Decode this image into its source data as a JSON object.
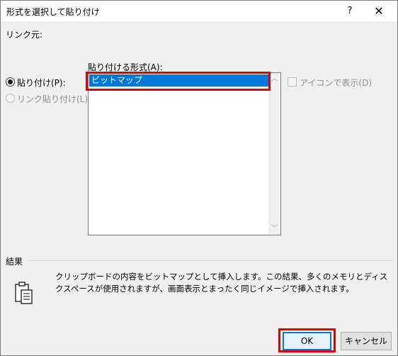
{
  "window": {
    "title": "形式を選択して貼り付け",
    "help_label": "?",
    "close_label": "✕"
  },
  "source": {
    "label": "リンク元:"
  },
  "paste_format": {
    "label": "貼り付ける形式(A):",
    "items": [
      {
        "label": "ビットマップ",
        "selected": true
      }
    ]
  },
  "options": {
    "paste_label": "貼り付け(P):",
    "paste_checked": true,
    "link_paste_label": "リンク貼り付け(L):",
    "link_paste_enabled": false
  },
  "display_as_icon": {
    "label": "アイコンで表示(D)",
    "checked": false,
    "enabled": false
  },
  "result": {
    "heading": "結果",
    "description": "クリップボードの内容をビットマップとして挿入します。この結果、多くのメモリとディスクスペースが使用されますが、画面表示とまったく同じイメージで挿入されます。"
  },
  "buttons": {
    "ok_label": "OK",
    "cancel_label": "キャンセル"
  },
  "colors": {
    "selection": "#0078d7",
    "highlight_box": "#e00000"
  },
  "icons": {
    "result_icon": "clipboard-paste-icon",
    "scroll_up": "chevron-up-icon",
    "scroll_down": "chevron-down-icon"
  }
}
